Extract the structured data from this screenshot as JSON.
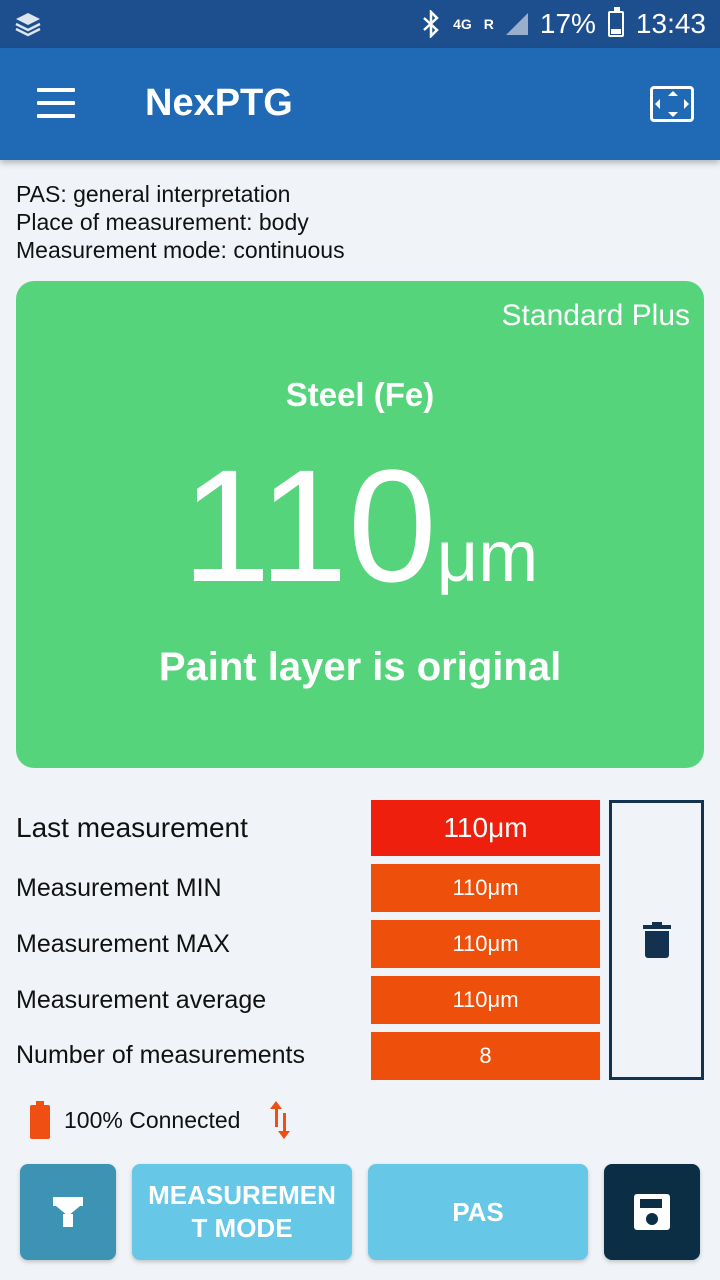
{
  "status_bar": {
    "network": "4G",
    "roaming": "R",
    "battery": "17%",
    "time": "13:43",
    "icons": [
      "layers-icon",
      "bluetooth-icon",
      "signal-icon",
      "battery-icon"
    ]
  },
  "app_bar": {
    "title": "NexPTG",
    "icons": [
      "menu-icon",
      "fullscreen-icon"
    ]
  },
  "info": {
    "pas": "PAS: general interpretation",
    "place": "Place of measurement: body",
    "mode": "Measurement mode: continuous"
  },
  "result": {
    "standard": "Standard Plus",
    "material": "Steel (Fe)",
    "value": "110",
    "unit": "μm",
    "verdict": "Paint layer is original",
    "color": "#55d47c"
  },
  "stats": [
    {
      "label": "Last measurement",
      "value": "110μm",
      "color": "#ee1f0c"
    },
    {
      "label": "Measurement MIN",
      "value": "110μm",
      "color": "#ee500c"
    },
    {
      "label": "Measurement MAX",
      "value": "110μm",
      "color": "#ee500c"
    },
    {
      "label": "Measurement average",
      "value": "110μm",
      "color": "#ee500c"
    },
    {
      "label": "Number of measurements",
      "value": "8",
      "color": "#ee500c"
    }
  ],
  "connection": {
    "text": "100% Connected",
    "icons": [
      "battery-icon",
      "sync-arrows-icon"
    ],
    "color": "#ef4f12"
  },
  "buttons": {
    "probe_icon": "probe-icon",
    "mode_label": "MEASUREMEN T MODE",
    "pas_label": "PAS",
    "save_icon": "save-icon"
  },
  "delete_icon": "trash-icon"
}
